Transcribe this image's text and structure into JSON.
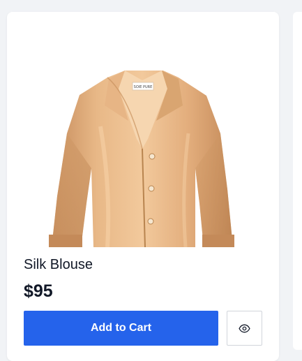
{
  "product": {
    "name": "Silk Blouse",
    "price": "$95",
    "image_alt": "Silk Blouse",
    "label_text": "SOIE PURE"
  },
  "actions": {
    "add_to_cart_label": "Add to Cart",
    "quick_view_icon": "eye-icon"
  },
  "colors": {
    "accent": "#2563eb",
    "text": "#111827",
    "fabric": "#e2b07f"
  }
}
